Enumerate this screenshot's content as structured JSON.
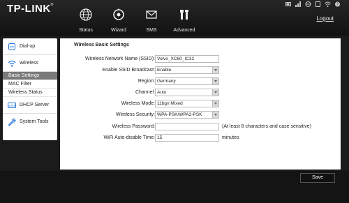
{
  "header": {
    "logo": "TP-LINK",
    "logo_mark": "®",
    "logout": "Logout",
    "nav": [
      {
        "label": "Status",
        "icon": "globe-icon"
      },
      {
        "label": "Wizard",
        "icon": "wizard-icon"
      },
      {
        "label": "SMS",
        "icon": "envelope-icon"
      },
      {
        "label": "Advanced",
        "icon": "tools-icon"
      }
    ],
    "status_icons": [
      "battery-icon",
      "signal-icon",
      "globe-status-icon",
      "sim-icon",
      "wifi-icon",
      "question-icon"
    ]
  },
  "sidebar": {
    "items": [
      {
        "label": "Dial-up",
        "icon": "dialup-icon"
      },
      {
        "label": "Wireless",
        "icon": "wireless-icon"
      },
      {
        "label": "DHCP Server",
        "icon": "dhcp-icon"
      },
      {
        "label": "System Tools",
        "icon": "wrench-icon"
      }
    ],
    "sub_items": [
      {
        "label": "Basic Settings",
        "active": true
      },
      {
        "label": "MAC Filter",
        "active": false
      },
      {
        "label": "Wireless Status",
        "active": false
      }
    ]
  },
  "main": {
    "title": "Wireless Basic Settings",
    "fields": {
      "ssid": {
        "label": "Wireless Network Name (SSID):",
        "value": "Volvo_XC60_IC32"
      },
      "broadcast": {
        "label": "Enable SSID Broadcast:",
        "value": "Enable"
      },
      "region": {
        "label": "Region:",
        "value": "Germany"
      },
      "channel": {
        "label": "Channel:",
        "value": "Auto"
      },
      "mode": {
        "label": "Wireless Mode:",
        "value": "11bgn Mixed"
      },
      "security": {
        "label": "Wireless Security:",
        "value": "WPA-PSK/WPA2-PSK"
      },
      "password": {
        "label": "Wireless Password:",
        "value": "",
        "hint": "(At least 8 characters and case sensitive)"
      },
      "autodisable": {
        "label": "WiFi Auto-disable Time:",
        "value": "15",
        "hint": "minutes"
      }
    }
  },
  "footer": {
    "save": "Save"
  },
  "colors": {
    "accent": "#1a6fd6",
    "header_bg": "#1b1b1b",
    "active_sub": "#7a7a7a"
  }
}
